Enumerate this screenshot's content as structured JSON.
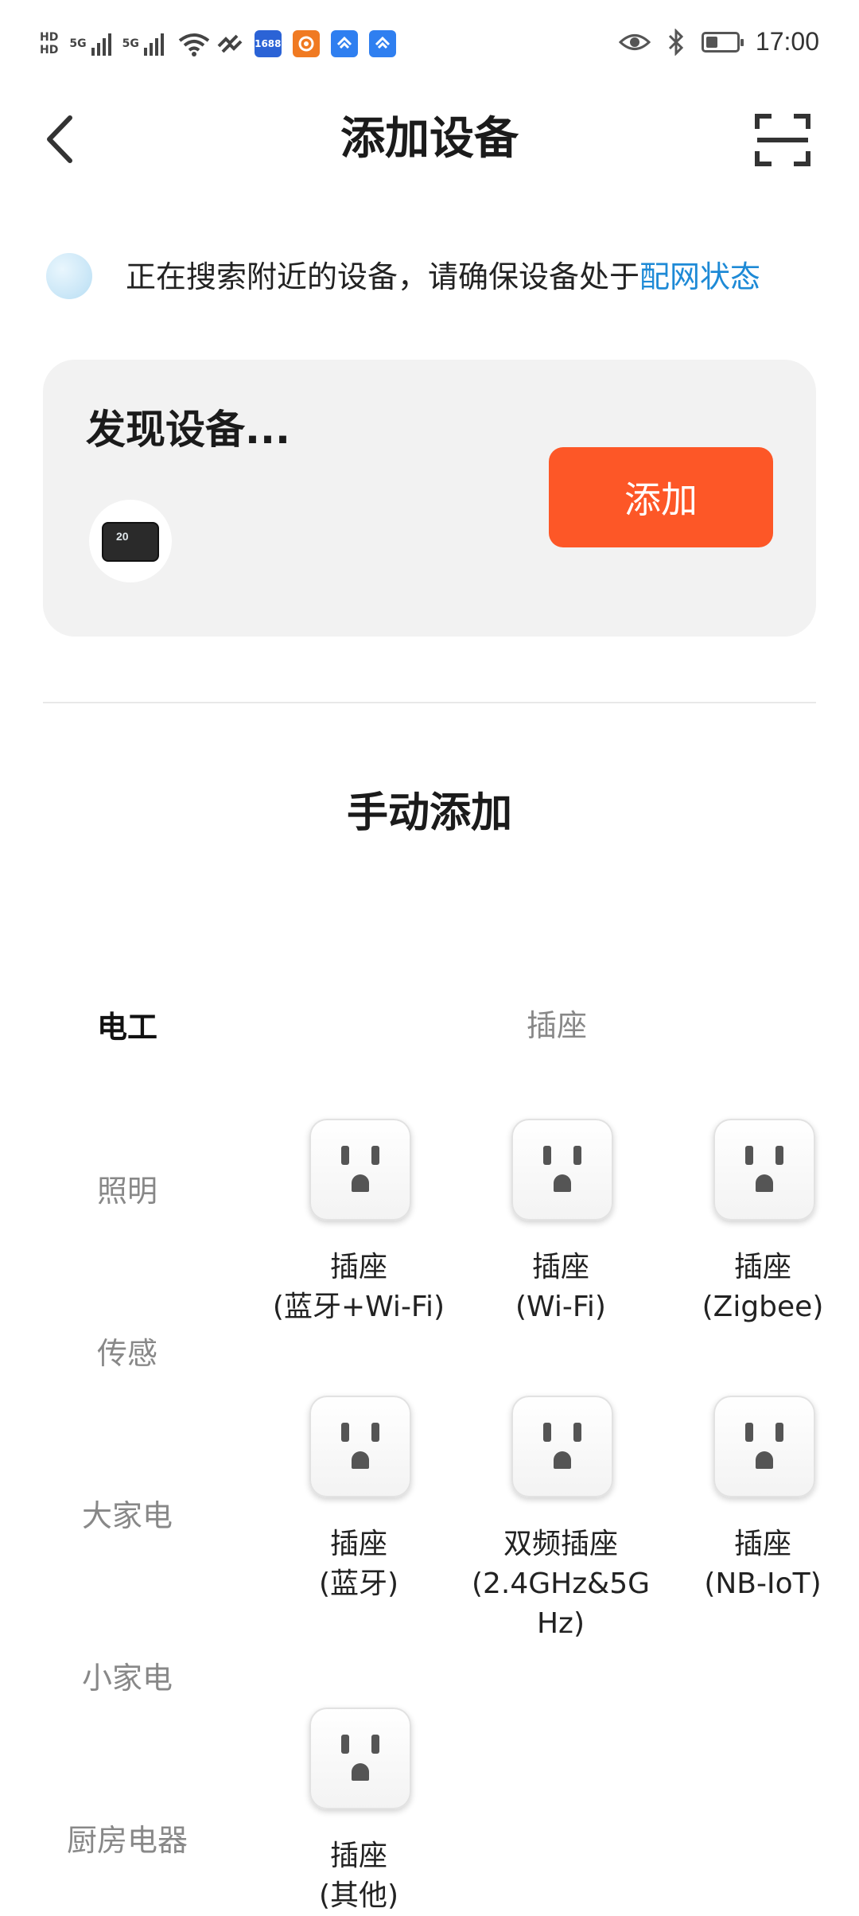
{
  "status_bar": {
    "hd_top": "HD",
    "hd_bottom": "HD",
    "network1": "5G",
    "network2": "5G",
    "app_badge": "1688",
    "time": "17:00",
    "battery_percent": 40,
    "icons": [
      "signal-icon",
      "wifi-icon",
      "vpn-icon",
      "app-1688-icon",
      "app-taobao-icon",
      "app-blue-icon",
      "app-blue2-icon",
      "eye-icon",
      "bluetooth-icon",
      "battery-icon"
    ]
  },
  "nav": {
    "title": "添加设备"
  },
  "search": {
    "text": "正在搜索附近的设备，请确保设备处于",
    "link": "配网状态"
  },
  "discovery": {
    "title": "发现设备...",
    "device_reading": "20",
    "add_label": "添加"
  },
  "manual": {
    "title": "手动添加"
  },
  "categories": [
    {
      "label": "电工",
      "active": true
    },
    {
      "label": "照明",
      "active": false
    },
    {
      "label": "传感",
      "active": false
    },
    {
      "label": "大家电",
      "active": false
    },
    {
      "label": "小家电",
      "active": false
    },
    {
      "label": "厨房电器",
      "active": false
    }
  ],
  "section": {
    "label": "插座"
  },
  "devices": [
    {
      "line1": "插座",
      "line2": "(蓝牙+Wi-Fi)",
      "line3": ""
    },
    {
      "line1": "插座",
      "line2": "(Wi-Fi)",
      "line3": ""
    },
    {
      "line1": "插座",
      "line2": "(Zigbee)",
      "line3": ""
    },
    {
      "line1": "插座",
      "line2": "(蓝牙)",
      "line3": ""
    },
    {
      "line1": "双频插座",
      "line2": "(2.4GHz&5G",
      "line3": "Hz)"
    },
    {
      "line1": "插座",
      "line2": "(NB-IoT)",
      "line3": ""
    },
    {
      "line1": "插座",
      "line2": "(其他)",
      "line3": ""
    }
  ],
  "colors": {
    "accent": "#fd5727",
    "link": "#1e8ad6",
    "card_bg": "#f2f2f2"
  }
}
